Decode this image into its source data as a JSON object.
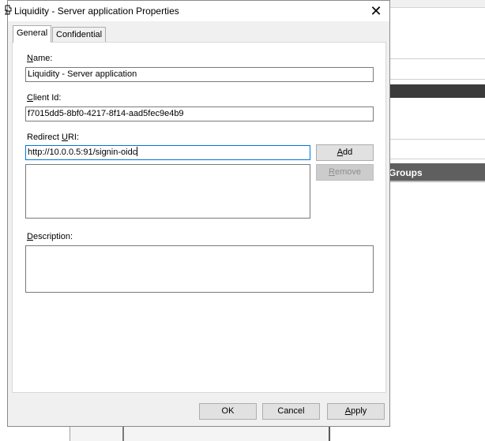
{
  "dialog": {
    "title": "Liquidity - Server application Properties",
    "close_glyph": "✕"
  },
  "tabs": [
    {
      "label": "General",
      "selected": true
    },
    {
      "label": "Confidential",
      "selected": false
    }
  ],
  "form": {
    "name_label_u": "N",
    "name_label_rest": "ame:",
    "name_value": "Liquidity - Server application",
    "client_label_u": "C",
    "client_label_rest": "lient Id:",
    "client_value": "f7015dd5-8bf0-4217-8f14-aad5fec9e4b9",
    "redirect_label_pre": "Redirect ",
    "redirect_label_u": "U",
    "redirect_label_rest": "RI:",
    "redirect_value": "http://10.0.0.5:91/signin-oidc",
    "add_button_u": "A",
    "add_button_rest": "dd",
    "remove_button_u": "R",
    "remove_button_rest": "emove",
    "description_label_u": "D",
    "description_label_rest": "escription:"
  },
  "footer": {
    "ok": "OK",
    "cancel": "Cancel",
    "apply_u": "A",
    "apply_rest": "pply"
  },
  "background": {
    "groups_label": "Groups"
  },
  "colors": {
    "focus_border": "#0078d7",
    "dialog_bg": "#f0f0f0"
  }
}
